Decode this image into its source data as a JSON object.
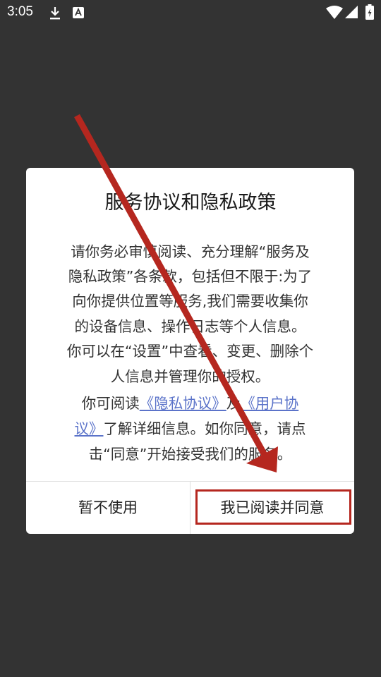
{
  "status_bar": {
    "time": "3:05",
    "icons": [
      "download-icon",
      "font-icon",
      "wifi-icon",
      "signal-icon",
      "battery-icon"
    ]
  },
  "dialog": {
    "title": "服务协议和隐私政策",
    "body_lines": [
      "请你务必审慎阅读、充分理解“服务及",
      "隐私政策”各条款，包括但不限于:为了",
      "向你提供位置等服务,我们需要收集你",
      "的设备信息、操作日志等个人信息。",
      "你可以在“设置”中查看、变更、删除个",
      "人信息并管理你的授权。"
    ],
    "link_line1_prefix": "你可阅读",
    "privacy_link_text": "《隐私协议》",
    "link_line1_and": "及",
    "user_agreement_link_part1": "《用户协",
    "user_agreement_link_part2": "议》",
    "link_line2_suffix": "了解详细信息。如你同意，请点",
    "last_line": "击“同意”开始接受我们的服务。",
    "cancel_button": "暂不使用",
    "agree_button": "我已阅读并同意"
  },
  "colors": {
    "backdrop": "#333333",
    "dialog_bg": "#ffffff",
    "link": "#5b73c9",
    "annotation_red": "#b5271f"
  }
}
